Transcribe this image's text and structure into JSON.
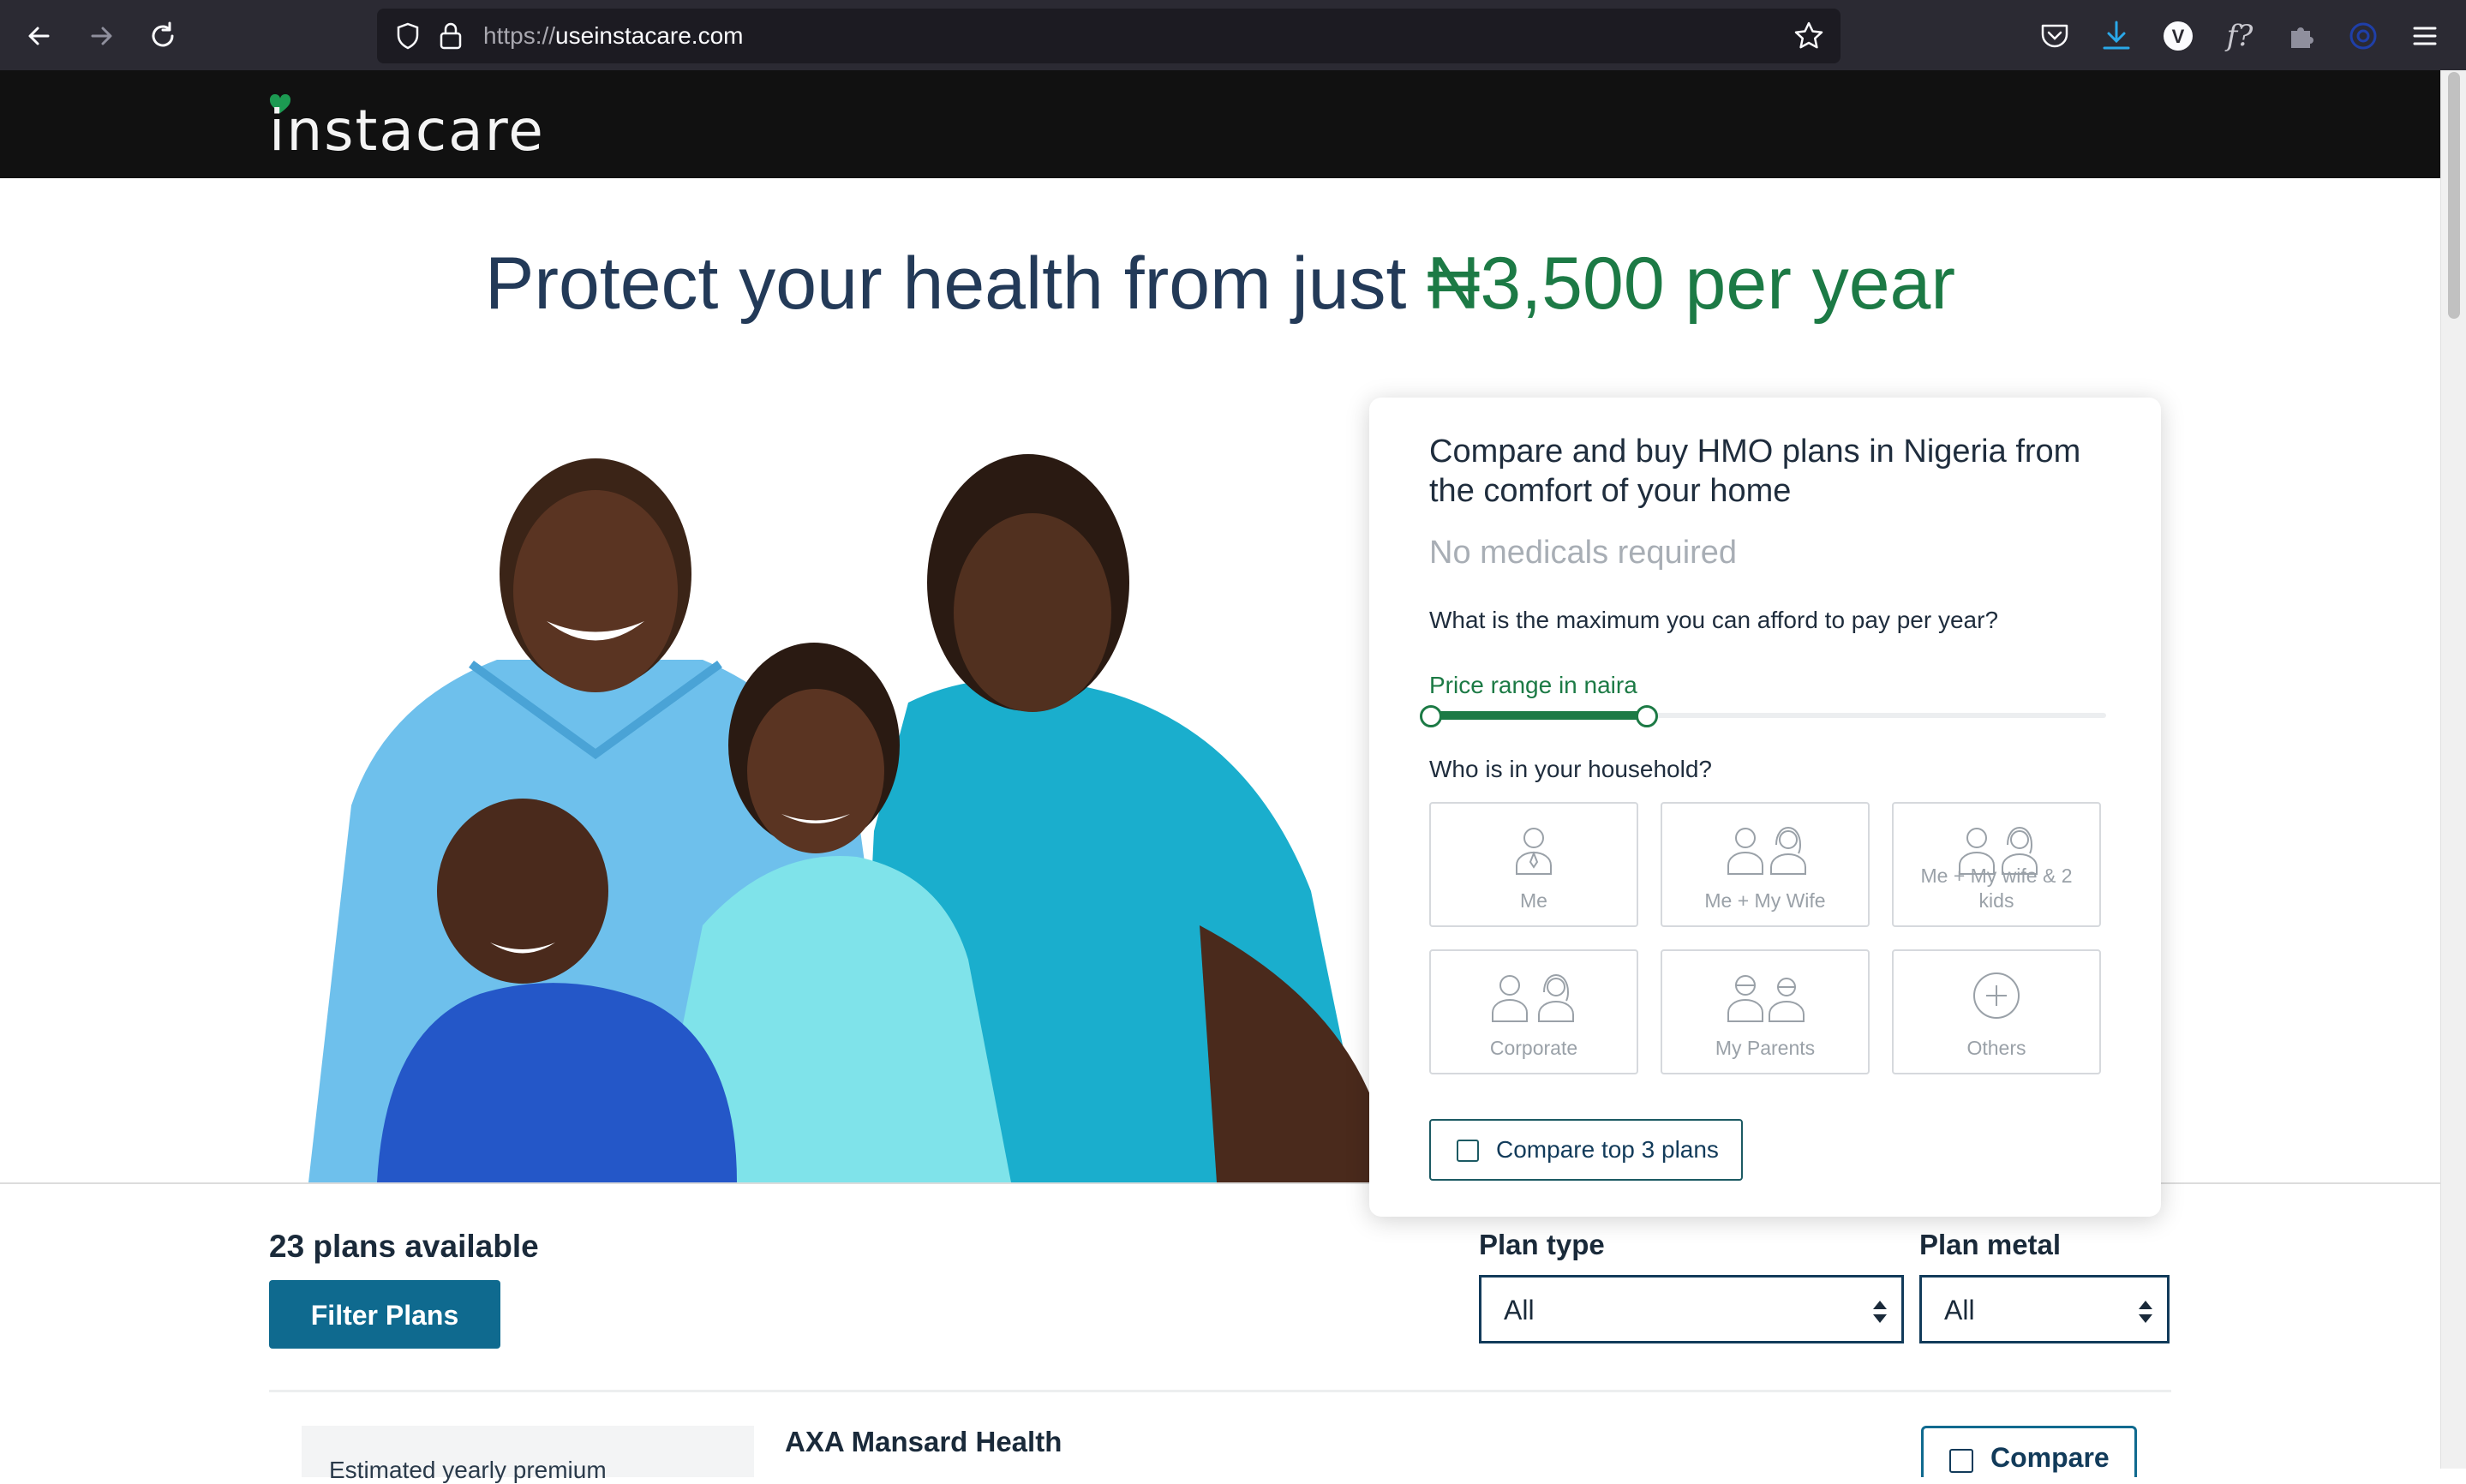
{
  "browser": {
    "url_scheme": "https://",
    "url_host": "useinstacare.com",
    "toolbar_text_icon": "f?"
  },
  "site": {
    "logo_text": "instacare"
  },
  "hero": {
    "title_prefix": "Protect your health from just ",
    "title_price": "₦3,500 per year"
  },
  "card": {
    "title": "Compare and buy HMO plans in Nigeria from the comfort of your home",
    "subtitle": "No medicals required",
    "question_price": "What is the maximum you can afford to pay per year?",
    "price_label": "Price range in naira",
    "price_range_fraction": [
      0.0,
      0.32
    ],
    "question_household": "Who is in your household?",
    "household": [
      {
        "label": "Me",
        "icon": "single-person-icon"
      },
      {
        "label": "Me + My Wife",
        "icon": "couple-icon"
      },
      {
        "label": "Me + My wife & 2 kids",
        "icon": "family-icon"
      },
      {
        "label": "Corporate",
        "icon": "corporate-icon"
      },
      {
        "label": "My Parents",
        "icon": "parents-icon"
      },
      {
        "label": "Others",
        "icon": "plus-circle-icon"
      }
    ],
    "compare_top_label": "Compare top 3 plans"
  },
  "plans": {
    "count_label": "23 plans available",
    "filter_button": "Filter Plans",
    "plan_type_label": "Plan type",
    "plan_type_value": "All",
    "plan_metal_label": "Plan metal",
    "plan_metal_value": "All",
    "first_plan_sidebar": "Estimated yearly premium",
    "first_plan_name": "AXA Mansard Health",
    "compare_label": "Compare"
  },
  "colors": {
    "brand_green": "#1c7a45",
    "navy": "#233a58",
    "teal_button": "#0f6a8f",
    "header_bg": "#111111"
  }
}
